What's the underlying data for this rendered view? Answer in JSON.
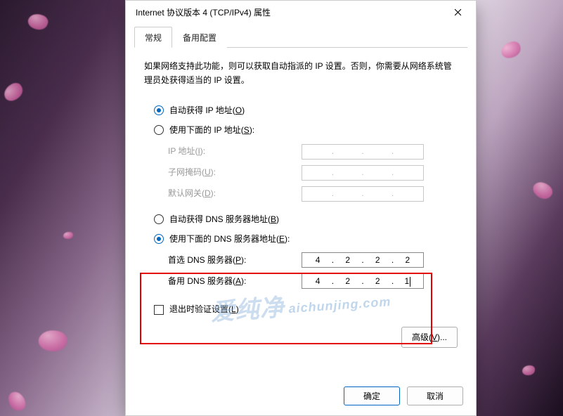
{
  "dialog": {
    "title": "Internet 协议版本 4 (TCP/IPv4) 属性",
    "close_aria": "关闭"
  },
  "tabs": {
    "general": "常规",
    "alternate": "备用配置"
  },
  "intro": "如果网络支持此功能，则可以获取自动指派的 IP 设置。否则，你需要从网络系统管理员处获得适当的 IP 设置。",
  "ip_section": {
    "auto_label": "自动获得 IP 地址(O)",
    "manual_label": "使用下面的 IP 地址(S):",
    "auto_checked": true,
    "fields": {
      "ip_label": "IP 地址(I):",
      "mask_label": "子网掩码(U):",
      "gateway_label": "默认网关(D):"
    }
  },
  "dns_section": {
    "auto_label": "自动获得 DNS 服务器地址(B)",
    "manual_label": "使用下面的 DNS 服务器地址(E):",
    "manual_checked": true,
    "preferred_label": "首选 DNS 服务器(P):",
    "alternate_label": "备用 DNS 服务器(A):",
    "preferred_value": [
      "4",
      "2",
      "2",
      "2"
    ],
    "alternate_value": [
      "4",
      "2",
      "2",
      "1"
    ]
  },
  "validate_label": "退出时验证设置(L)",
  "advanced_label": "高级(V)...",
  "buttons": {
    "ok": "确定",
    "cancel": "取消"
  },
  "watermark": {
    "main": "爱纯净",
    "sub": "aichunjing.com"
  },
  "dot": "."
}
